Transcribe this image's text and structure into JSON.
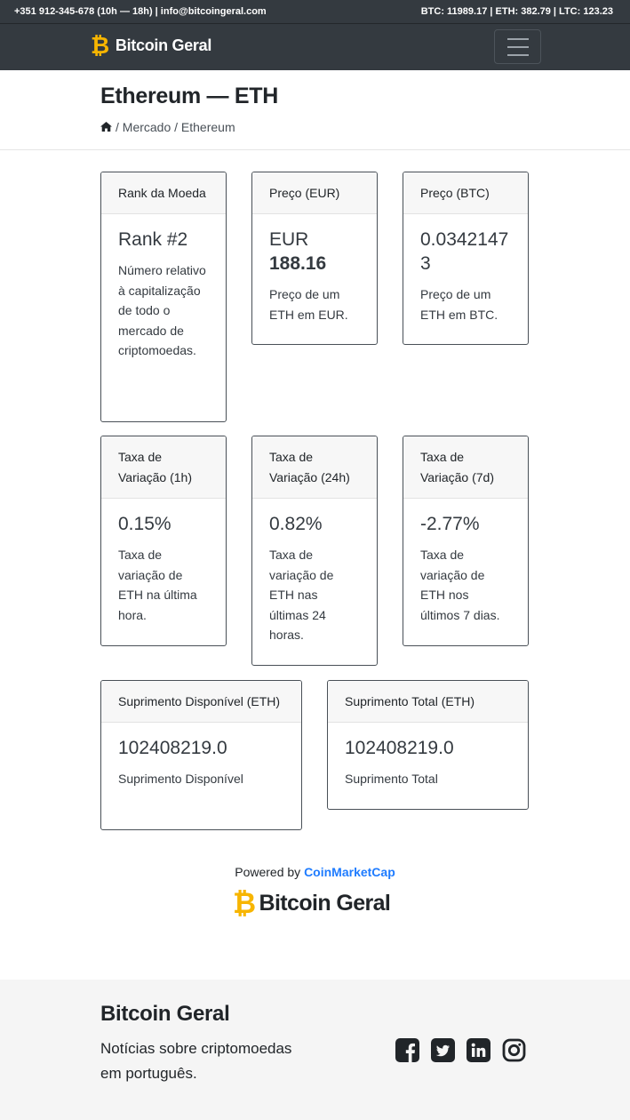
{
  "topbar": {
    "contact": "+351 912-345-678 (10h — 18h)  |  info@bitcoingeral.com",
    "tickers": "BTC: 11989.17 | ETH: 382.79 | LTC: 123.23"
  },
  "navbar": {
    "brand_symbol": "₿",
    "brand_name": "Bitcoin Geral",
    "menu_icon": "hamburger-icon"
  },
  "header": {
    "title": "Ethereum — ETH",
    "breadcrumb": {
      "home_icon": "home-icon",
      "text": " / Mercado / Ethereum"
    }
  },
  "cards": {
    "rank": {
      "header": "Rank da Moeda",
      "value": "Rank #2",
      "text": "Número relativo à capitalização de todo o mercado de criptomoedas."
    },
    "price_eur": {
      "header": "Preço (EUR)",
      "value_prefix": "EUR",
      "value": "188.16",
      "text": "Preço de um ETH em EUR."
    },
    "price_btc": {
      "header": "Preço (BTC)",
      "value": "0.03421473",
      "text": "Preço de um ETH em BTC."
    },
    "change_1h": {
      "header": "Taxa de Variação (1h)",
      "value": "0.15%",
      "text": "Taxa de variação de ETH na última hora."
    },
    "change_24h": {
      "header": "Taxa de Variação (24h)",
      "value": "0.82%",
      "text": "Taxa de variação de ETH nas últimas 24 horas."
    },
    "change_7d": {
      "header": "Taxa de Variação (7d)",
      "value": "-2.77%",
      "text": "Taxa de variação de ETH nos últimos 7 dias."
    },
    "supply_available": {
      "header": "Suprimento Disponível (ETH)",
      "value": "102408219.0",
      "text": "Suprimento Disponível"
    },
    "supply_total": {
      "header": "Suprimento Total (ETH)",
      "value": "102408219.0",
      "text": "Suprimento Total"
    }
  },
  "powered": {
    "prefix": "Powered by ",
    "link": "CoinMarketCap",
    "logo_symbol": "₿",
    "logo_text": "Bitcoin Geral"
  },
  "footer": {
    "title": "Bitcoin Geral",
    "description": "Notícias sobre criptomoedas em português.",
    "social": [
      "facebook-icon",
      "twitter-icon",
      "linkedin-icon",
      "instagram-icon"
    ]
  },
  "colors": {
    "dark": "#343a40",
    "accent": "#f7b500",
    "link": "#1f7cff",
    "footer_bg": "#f5f5f5"
  }
}
